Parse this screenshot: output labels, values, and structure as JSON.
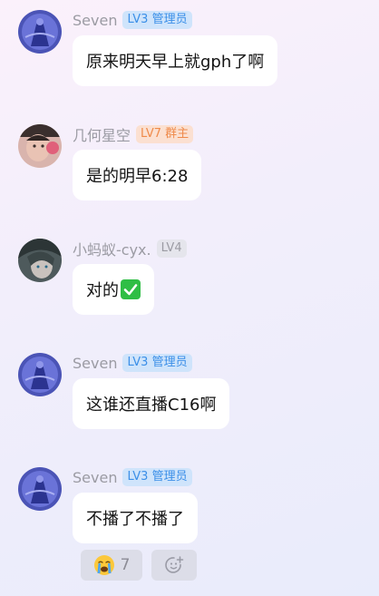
{
  "messages": [
    {
      "sender": "Seven",
      "badge": "LV3 管理员",
      "badge_type": "admin",
      "avatar_icon": "avatar-blue-figure",
      "text": "原来明天早上就gph了啊"
    },
    {
      "sender": "几何星空",
      "badge": "LV7 群主",
      "badge_type": "owner",
      "avatar_icon": "avatar-person-pink",
      "text": "是的明早6:28"
    },
    {
      "sender": "小蚂蚁-cyx.",
      "badge": "LV4",
      "badge_type": "plain",
      "avatar_icon": "avatar-anime-dark",
      "text": "对的",
      "emoji": "check-mark-emoji"
    },
    {
      "sender": "Seven",
      "badge": "LV3 管理员",
      "badge_type": "admin",
      "avatar_icon": "avatar-blue-figure",
      "text": "这谁还直播C16啊"
    },
    {
      "sender": "Seven",
      "badge": "LV3 管理员",
      "badge_type": "admin",
      "avatar_icon": "avatar-blue-figure",
      "text": "不播了不播了"
    }
  ],
  "reactions": [
    {
      "icon": "crying-face-emoji",
      "count": "7"
    },
    {
      "icon": "add-reaction-icon"
    }
  ],
  "colors": {
    "admin_badge_bg": "#cfe4fb",
    "admin_badge_text": "#3b8fe8",
    "owner_badge_bg": "#fbe0d1",
    "owner_badge_text": "#ef8a4a",
    "plain_badge_bg": "#e5e5ec",
    "plain_badge_text": "#9b9ba3"
  }
}
